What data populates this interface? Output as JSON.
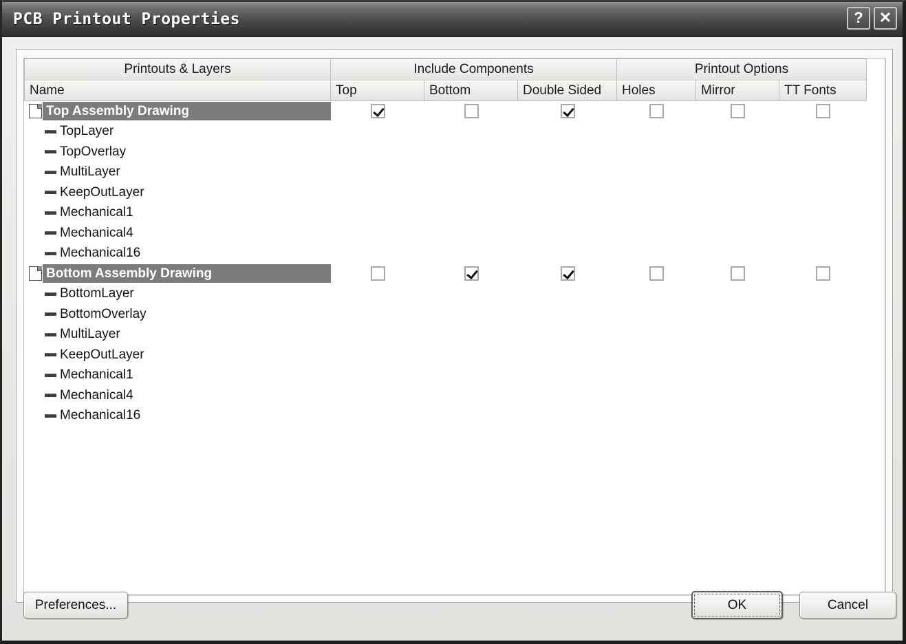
{
  "window": {
    "title": "PCB Printout Properties",
    "buttons": [
      {
        "name": "help-button",
        "glyph": "?"
      },
      {
        "name": "close-button",
        "glyph": "✕"
      }
    ]
  },
  "table": {
    "group_headers": [
      {
        "label": "Printouts & Layers"
      },
      {
        "label": "Include Components"
      },
      {
        "label": "Printout Options"
      }
    ],
    "column_headers": [
      {
        "label": "Name"
      },
      {
        "label": "Top"
      },
      {
        "label": "Bottom"
      },
      {
        "label": "Double Sided"
      },
      {
        "label": "Holes"
      },
      {
        "label": "Mirror"
      },
      {
        "label": "TT Fonts"
      }
    ],
    "printouts": [
      {
        "name": "Top Assembly Drawing",
        "selected": true,
        "options": {
          "top": true,
          "bottom": false,
          "double_sided": true,
          "holes": false,
          "mirror": false,
          "tt_fonts": false
        },
        "layers": [
          "TopLayer",
          "TopOverlay",
          "MultiLayer",
          "KeepOutLayer",
          "Mechanical1",
          "Mechanical4",
          "Mechanical16"
        ]
      },
      {
        "name": "Bottom Assembly Drawing",
        "selected": true,
        "options": {
          "top": false,
          "bottom": true,
          "double_sided": true,
          "holes": false,
          "mirror": false,
          "tt_fonts": false
        },
        "layers": [
          "BottomLayer",
          "BottomOverlay",
          "MultiLayer",
          "KeepOutLayer",
          "Mechanical1",
          "Mechanical4",
          "Mechanical16"
        ]
      }
    ]
  },
  "footer": {
    "preferences_label": "Preferences...",
    "ok_label": "OK",
    "cancel_label": "Cancel"
  },
  "colors": {
    "selection": "#7c7c7c",
    "titlebar": "#4b4b4b",
    "dialog_face": "#ece9e3"
  }
}
